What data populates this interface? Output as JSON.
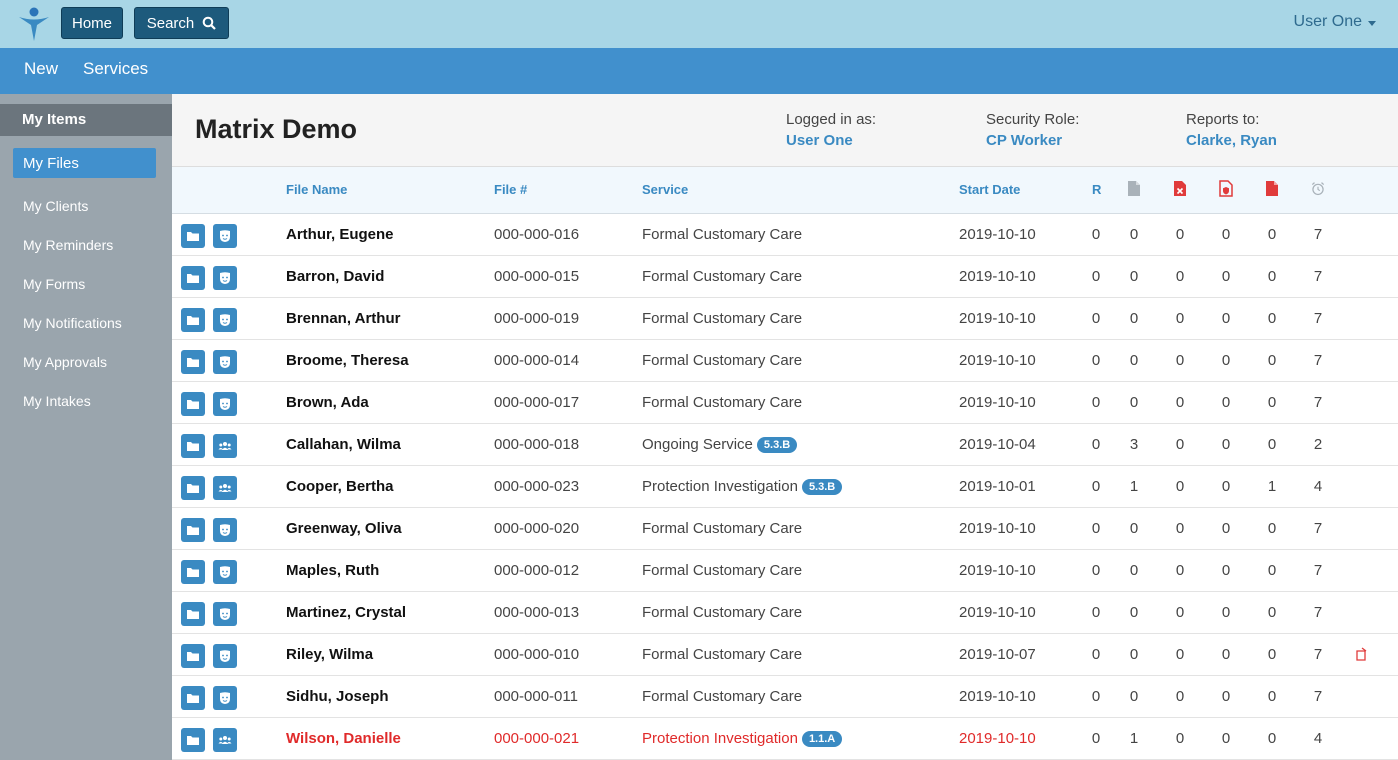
{
  "header": {
    "home_label": "Home",
    "search_label": "Search",
    "user_label": "User One"
  },
  "nav": {
    "new_label": "New",
    "services_label": "Services"
  },
  "sidebar": {
    "heading": "My Items",
    "active": "My Files",
    "items": [
      "My Clients",
      "My Reminders",
      "My Forms",
      "My Notifications",
      "My Approvals",
      "My Intakes"
    ]
  },
  "page": {
    "title": "Matrix Demo",
    "logged_in_label": "Logged in as:",
    "logged_in_value": "User One",
    "role_label": "Security Role:",
    "role_value": "CP Worker",
    "reports_label": "Reports to:",
    "reports_value": "Clarke, Ryan"
  },
  "table": {
    "columns": {
      "name": "File Name",
      "file": "File #",
      "service": "Service",
      "start": "Start Date",
      "r": "R"
    },
    "rows": [
      {
        "name": "Arthur, Eugene",
        "file": "000-000-016",
        "service": "Formal Customary Care",
        "badge": "",
        "start": "2019-10-10",
        "r": "0",
        "c1": "0",
        "c2": "0",
        "c3": "0",
        "c4": "0",
        "c5": "7"
      },
      {
        "name": "Barron, David",
        "file": "000-000-015",
        "service": "Formal Customary Care",
        "badge": "",
        "start": "2019-10-10",
        "r": "0",
        "c1": "0",
        "c2": "0",
        "c3": "0",
        "c4": "0",
        "c5": "7"
      },
      {
        "name": "Brennan, Arthur",
        "file": "000-000-019",
        "service": "Formal Customary Care",
        "badge": "",
        "start": "2019-10-10",
        "r": "0",
        "c1": "0",
        "c2": "0",
        "c3": "0",
        "c4": "0",
        "c5": "7"
      },
      {
        "name": "Broome, Theresa",
        "file": "000-000-014",
        "service": "Formal Customary Care",
        "badge": "",
        "start": "2019-10-10",
        "r": "0",
        "c1": "0",
        "c2": "0",
        "c3": "0",
        "c4": "0",
        "c5": "7"
      },
      {
        "name": "Brown, Ada",
        "file": "000-000-017",
        "service": "Formal Customary Care",
        "badge": "",
        "start": "2019-10-10",
        "r": "0",
        "c1": "0",
        "c2": "0",
        "c3": "0",
        "c4": "0",
        "c5": "7"
      },
      {
        "name": "Callahan, Wilma",
        "file": "000-000-018",
        "service": "Ongoing Service",
        "badge": "5.3.B",
        "start": "2019-10-04",
        "r": "0",
        "c1": "3",
        "c2": "0",
        "c3": "0",
        "c4": "0",
        "c5": "2"
      },
      {
        "name": "Cooper, Bertha",
        "file": "000-000-023",
        "service": "Protection Investigation",
        "badge": "5.3.B",
        "start": "2019-10-01",
        "r": "0",
        "c1": "1",
        "c2": "0",
        "c3": "0",
        "c4": "1",
        "c5": "4"
      },
      {
        "name": "Greenway, Oliva",
        "file": "000-000-020",
        "service": "Formal Customary Care",
        "badge": "",
        "start": "2019-10-10",
        "r": "0",
        "c1": "0",
        "c2": "0",
        "c3": "0",
        "c4": "0",
        "c5": "7"
      },
      {
        "name": "Maples, Ruth",
        "file": "000-000-012",
        "service": "Formal Customary Care",
        "badge": "",
        "start": "2019-10-10",
        "r": "0",
        "c1": "0",
        "c2": "0",
        "c3": "0",
        "c4": "0",
        "c5": "7"
      },
      {
        "name": "Martinez, Crystal",
        "file": "000-000-013",
        "service": "Formal Customary Care",
        "badge": "",
        "start": "2019-10-10",
        "r": "0",
        "c1": "0",
        "c2": "0",
        "c3": "0",
        "c4": "0",
        "c5": "7"
      },
      {
        "name": "Riley, Wilma",
        "file": "000-000-010",
        "service": "Formal Customary Care",
        "badge": "",
        "start": "2019-10-07",
        "r": "0",
        "c1": "0",
        "c2": "0",
        "c3": "0",
        "c4": "0",
        "c5": "7"
      },
      {
        "name": "Sidhu, Joseph",
        "file": "000-000-011",
        "service": "Formal Customary Care",
        "badge": "",
        "start": "2019-10-10",
        "r": "0",
        "c1": "0",
        "c2": "0",
        "c3": "0",
        "c4": "0",
        "c5": "7"
      },
      {
        "name": "Wilson, Danielle",
        "file": "000-000-021",
        "service": "Protection Investigation",
        "badge": "1.1.A",
        "start": "2019-10-10",
        "r": "0",
        "c1": "1",
        "c2": "0",
        "c3": "0",
        "c4": "0",
        "c5": "4"
      }
    ]
  },
  "colors": {
    "accent": "#4190cd",
    "topbar": "#a8d6e6",
    "alert": "#e02a2a"
  }
}
